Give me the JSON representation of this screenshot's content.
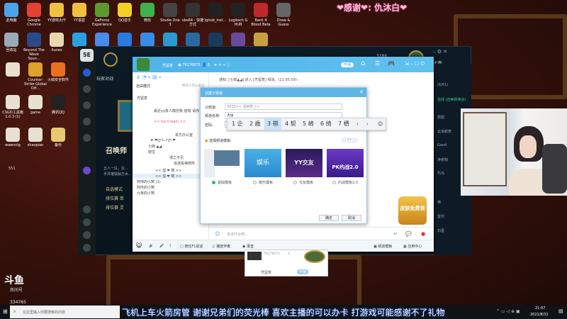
{
  "overlay_thanks": "❤感谢❤: 仇沐白❤",
  "desktop_icons": [
    {
      "label": "此电脑",
      "color": "#4aa3e8"
    },
    {
      "label": "Google Chrome",
      "color": "#e34133"
    },
    {
      "label": "YY游戏大厅",
      "color": "#f0c040"
    },
    {
      "label": "YY语音",
      "color": "#f0c040"
    },
    {
      "label": "GeForce Experience",
      "color": "#5a9a2a"
    },
    {
      "label": "QQ音乐",
      "color": "#f4d020"
    },
    {
      "label": "微信",
      "color": "#3cb34a"
    },
    {
      "label": "Studio One 3",
      "color": "#444"
    },
    {
      "label": "obs64 - 快捷方式",
      "color": "#333"
    },
    {
      "label": "lghub_inst...",
      "color": "#222"
    },
    {
      "label": "Logitech G HUB",
      "color": "#222"
    },
    {
      "label": "Back 4 Blood Beta",
      "color": "#c0282a"
    },
    {
      "label": "Draw & Guess",
      "color": "#666"
    }
  ],
  "desktop_icons_row2": [
    {
      "label": "回收站",
      "color": "#9ab"
    },
    {
      "label": "Beyond The Wave Soun...",
      "color": "#2a4a8a"
    },
    {
      "label": "itunes",
      "color": "#e8d8b0"
    },
    {
      "label": "",
      "color": "#2aa0e0"
    },
    {
      "label": "",
      "color": "#4a8ae8"
    },
    {
      "label": "",
      "color": "#2a7ae0"
    },
    {
      "label": "",
      "color": "#3a8ae8"
    },
    {
      "label": "",
      "color": "#2a9ad0"
    },
    {
      "label": "",
      "color": "#2a6aa0"
    },
    {
      "label": "",
      "color": "#1a3a5a"
    },
    {
      "label": "",
      "color": "#6a4a9a"
    },
    {
      "label": "",
      "color": "#c8a040"
    }
  ],
  "desktop_icons_left": [
    {
      "label": "",
      "color": "#e8e0d0"
    },
    {
      "label": "Counter-Strike Global Off...",
      "color": "#e0a030"
    },
    {
      "label": "火绒安全软件",
      "color": "#e87020"
    },
    {
      "label": "CSGO工具箱 1.0.3 (1)",
      "color": "#e8e0d0"
    },
    {
      "label": "game",
      "color": "#e8e0d0"
    },
    {
      "label": "腾讯QQ",
      "color": "#222"
    },
    {
      "label": "wwenclg",
      "color": "#e8e0d0"
    },
    {
      "label": "zhaopian",
      "color": "#e8e0d0"
    },
    {
      "label": "备份",
      "color": "#e8c870"
    }
  ],
  "desktop_extra_label": "551",
  "lol": {
    "tab": "玩家对战",
    "title": "召唤师",
    "desc": "五人一队，在...",
    "desc2": "手并摧毁敌方水...",
    "modes": [
      "自选模式",
      "排位赛 单",
      "排位赛 灵"
    ],
    "currency": "3186",
    "player": "七七郎"
  },
  "yy": {
    "channel_name": "凭留意",
    "channel_id": "79176075",
    "online_count": "6",
    "toggle": "开播",
    "mode": "自由模式",
    "mode_note": "所有人可以发言",
    "notice": "通知: [七郎▲◢] 进入 [凭留意] 频道。(21:05:59)",
    "tree": [
      "凭留意",
      "最近yy有人模仿我 借钱 请你",
      "<< Ice Cream >>",
      "单方办公室",
      "★ ❤ლ•̀ᴗ•́ლ ❤",
      "七郎 ▲◢",
      "晓宝",
      "漫之不见",
      "追迷看禅修所",
      "<< 溜 ❤ 窝 >>",
      "<< 溜 ❤ 窝 >>",
      "阿伟的小窝 (1)",
      "阿杰的小窝",
      "九条的小窝"
    ],
    "chat_placeholder": "说点什么吧...",
    "toolbar": [
      "按住F1说话",
      "播放伴奏",
      "录音",
      "频道模板",
      "应用中心"
    ]
  },
  "dialog": {
    "title": "创建子频道",
    "parent_label": "父频道:",
    "parent_value": "0000<< 溜❤窝 >>",
    "name_label": "频道名称:",
    "name_value": "大qi",
    "password_label": "密码:",
    "template_label": "选择频道模板:",
    "templates": [
      {
        "label": "基础模板",
        "selected": true,
        "art": ""
      },
      {
        "label": "娱乐模板",
        "selected": false,
        "art": "娱乐"
      },
      {
        "label": "交友模板",
        "selected": false,
        "art": "YY交友"
      },
      {
        "label": "约战模板2.0",
        "selected": false,
        "art": "PK约战2.0"
      }
    ],
    "ok": "确定",
    "cancel": "取消"
  },
  "ime": {
    "candidates": [
      "1 企",
      "2 歳",
      "3 祺",
      "4 契",
      "5 崎",
      "6 绮",
      "7 栖"
    ],
    "selected_index": 2
  },
  "mini_popup": {
    "id": "79176075",
    "count": "2",
    "name": "凭留意",
    "toggle": "开播"
  },
  "promo": "皮肤免费领",
  "friends": {
    "count": "(6/61)",
    "group": "在线 (召唤师峡谷)",
    "items": [
      "凯昭",
      "云诉颜表",
      "Good",
      "净奈狗",
      "TUS",
      "",
      "神",
      "雷尔",
      "石墨"
    ]
  },
  "douyu": {
    "logo": "斗鱼",
    "label": "房间号",
    "room": "334765"
  },
  "danmaku": "飞机上车火箭房管 谢谢兄弟们的荧光棒 喜欢主播的可以办卡 打游戏可能感谢不了礼物",
  "taskbar": {
    "search_placeholder": "在这里输入你要搜索的内容",
    "time": "21:07",
    "date": "2021/8/31"
  }
}
